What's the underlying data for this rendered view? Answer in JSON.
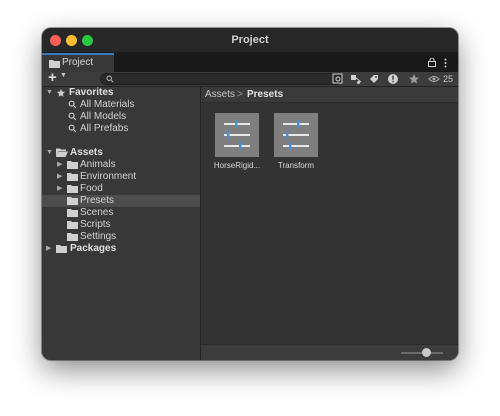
{
  "window": {
    "title": "Project"
  },
  "tab": {
    "label": "Project",
    "icon": "folder-icon"
  },
  "toolbar": {
    "create_label": "+",
    "search_placeholder": "",
    "hidden_count": "25"
  },
  "sidebar": {
    "favorites": {
      "label": "Favorites",
      "items": [
        {
          "label": "All Materials"
        },
        {
          "label": "All Models"
        },
        {
          "label": "All Prefabs"
        }
      ]
    },
    "assets": {
      "label": "Assets",
      "items": [
        {
          "label": "Animals",
          "expandable": true
        },
        {
          "label": "Environment",
          "expandable": true
        },
        {
          "label": "Food",
          "expandable": true
        },
        {
          "label": "Presets",
          "expandable": false,
          "selected": true
        },
        {
          "label": "Scenes",
          "expandable": false
        },
        {
          "label": "Scripts",
          "expandable": false
        },
        {
          "label": "Settings",
          "expandable": false
        }
      ]
    },
    "packages": {
      "label": "Packages"
    }
  },
  "breadcrumb": {
    "root": "Assets",
    "separator": ">",
    "current": "Presets"
  },
  "assets_grid": [
    {
      "label": "HorseRigid..."
    },
    {
      "label": "Transform"
    }
  ],
  "colors": {
    "accent": "#3a79bb",
    "window_bg": "#383838",
    "selection": "#4d4d4d",
    "preset_slider": "#4a8fd6"
  }
}
